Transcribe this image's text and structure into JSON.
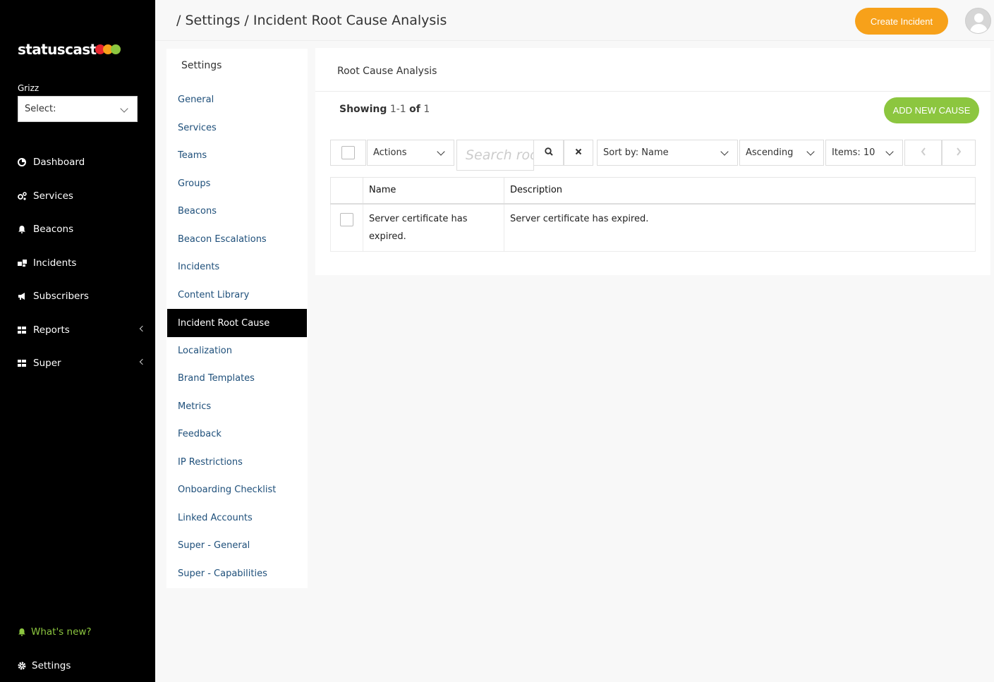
{
  "app": {
    "brand": "statuscast",
    "brand_dot_colors": [
      "#e8262e",
      "#f7a11a",
      "#8cc63f"
    ]
  },
  "sidebar": {
    "org_label": "Grizz",
    "org_select": "Select:",
    "items": [
      {
        "label": "Dashboard",
        "icon": "dashboard-icon"
      },
      {
        "label": "Services",
        "icon": "services-icon"
      },
      {
        "label": "Beacons",
        "icon": "bell-icon"
      },
      {
        "label": "Incidents",
        "icon": "incidents-icon"
      },
      {
        "label": "Subscribers",
        "icon": "megaphone-icon"
      },
      {
        "label": "Reports",
        "icon": "grid-icon"
      },
      {
        "label": "Super",
        "icon": "grid-icon"
      }
    ],
    "whats_new": "What's new?",
    "settings": "Settings"
  },
  "header": {
    "breadcrumb": "/ Settings / Incident Root Cause Analysis",
    "create_button": "Create Incident"
  },
  "settings_panel": {
    "title": "Settings",
    "items": [
      "General",
      "Services",
      "Teams",
      "Groups",
      "Beacons",
      "Beacon Escalations",
      "Incidents",
      "Content Library",
      "Incident Root Cause",
      "Localization",
      "Brand Templates",
      "Metrics",
      "Feedback",
      "IP Restrictions",
      "Onboarding Checklist",
      "Linked Accounts",
      "Super - General",
      "Super - Capabilities"
    ],
    "active": "Incident Root Cause"
  },
  "main": {
    "title": "Root Cause Analysis",
    "showing_label": "Showing",
    "showing_range": "1-1",
    "of_label": "of",
    "showing_total": "1",
    "add_button": "ADD NEW CAUSE",
    "actions": "Actions",
    "search_placeholder": "Search root causes",
    "sort": "Sort by: Name",
    "order": "Ascending",
    "items": "Items: 10",
    "table": {
      "headers": [
        "",
        "Name",
        "Description"
      ],
      "rows": [
        {
          "name": "Server certificate has expired.",
          "description": "Server certificate has expired."
        }
      ]
    }
  }
}
